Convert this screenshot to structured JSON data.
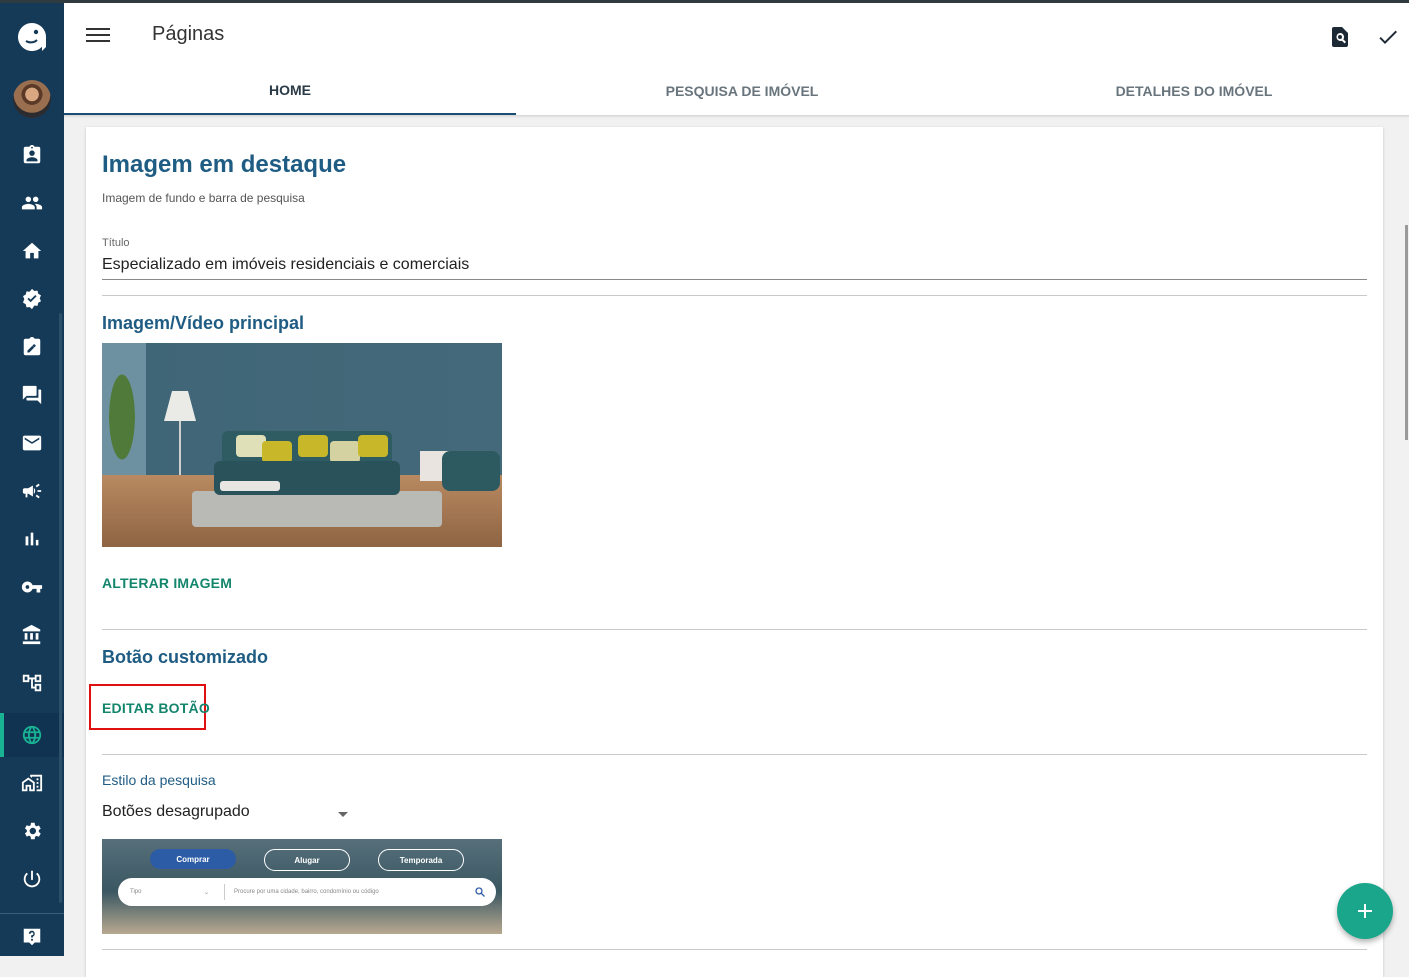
{
  "app": {
    "page_title": "Páginas"
  },
  "tabs": [
    {
      "label": "HOME",
      "active": true
    },
    {
      "label": "PESQUISA DE IMÓVEL",
      "active": false
    },
    {
      "label": "DETALHES DO IMÓVEL",
      "active": false
    }
  ],
  "sidebar": {
    "items": [
      {
        "icon": "clipboard-account-icon"
      },
      {
        "icon": "people-icon"
      },
      {
        "icon": "home-icon"
      },
      {
        "icon": "badge-check-icon"
      },
      {
        "icon": "edit-document-icon"
      },
      {
        "icon": "chat-icon"
      },
      {
        "icon": "mail-icon"
      },
      {
        "icon": "megaphone-icon"
      },
      {
        "icon": "bar-chart-icon"
      },
      {
        "icon": "key-icon"
      },
      {
        "icon": "bank-icon"
      },
      {
        "icon": "hierarchy-icon"
      },
      {
        "icon": "globe-icon",
        "active": true
      },
      {
        "icon": "real-estate-icon"
      },
      {
        "icon": "gear-icon"
      },
      {
        "icon": "power-icon"
      }
    ],
    "bottom_icon": "help-icon"
  },
  "header_actions": [
    "preview-search-icon",
    "check-icon"
  ],
  "featured": {
    "title": "Imagem em destaque",
    "subtitle": "Imagem de fundo e barra de pesquisa",
    "field_label": "Título",
    "field_value": "Especializado em imóveis residenciais e comerciais",
    "media_title": "Imagem/Vídeo principal",
    "change_image": "ALTERAR IMAGEM",
    "custom_button_title": "Botão customizado",
    "edit_button": "EDITAR BOTÃO",
    "search_style_label": "Estilo da pesquisa",
    "search_style_value": "Botões desagrupado"
  },
  "search_preview": {
    "buttons": [
      "Comprar",
      "Alugar",
      "Temporada"
    ],
    "type_placeholder": "Tipo",
    "search_placeholder": "Procure por uma cidade, bairro, condomínio ou código"
  },
  "colors": {
    "sidebar": "#153a57",
    "accent": "#19a68a",
    "title_blue": "#1f5c84",
    "highlight": "#e01010"
  }
}
